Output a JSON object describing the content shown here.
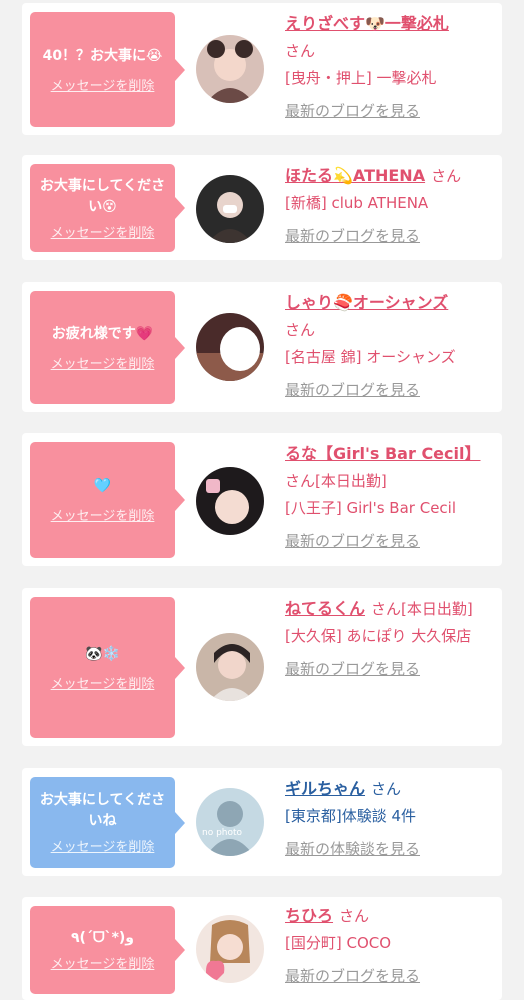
{
  "delete_label": "メッセージを削除",
  "colors": {
    "pink_bubble": "#f8909e",
    "blue_bubble": "#89b8ee",
    "pink_text": "#e0506e",
    "blue_text": "#2a5fa0"
  },
  "cards": [
    {
      "message": "40！？お大事に😭",
      "name": "えりざべす🐶一撃必札",
      "suffix": "さん",
      "details": [
        "[曳舟・押上] 一撃必札"
      ],
      "link": "最新のブログを見る"
    },
    {
      "message": "お大事にしてください😵",
      "name": "ほたる💫ATHENA",
      "suffix": "さん",
      "details": [
        "[新橋] club ATHENA"
      ],
      "link": "最新のブログを見る"
    },
    {
      "message": "お疲れ様です💗",
      "name": "しゃり🍣オーシャンズ",
      "suffix": "さん",
      "details": [
        "[名古屋 錦] オーシャンズ"
      ],
      "link": "最新のブログを見る"
    },
    {
      "message": "🩵",
      "name": "るな【Girl's Bar Cecil】",
      "suffix": "さん[本日出勤]",
      "details": [
        "[八王子] Girl's Bar Cecil"
      ],
      "link": "最新のブログを見る"
    },
    {
      "message": "🐼❄️",
      "name": "ねてるくん",
      "suffix": "さん[本日出勤]",
      "details": [
        "[大久保] あにぽり 大久保店"
      ],
      "link": "最新のブログを見る"
    },
    {
      "message": "お大事にしてくださいね",
      "name": "ギルちゃん",
      "suffix": "さん",
      "details": [
        "[東京都]体験談 4件"
      ],
      "link": "最新の体験談を見る",
      "avatar_text": "no photo"
    },
    {
      "message": "٩(ˊᗜˋ*)و",
      "name": "ちひろ",
      "suffix": "さん",
      "details": [
        "[国分町] COCO"
      ],
      "link": "最新のブログを見る"
    }
  ]
}
